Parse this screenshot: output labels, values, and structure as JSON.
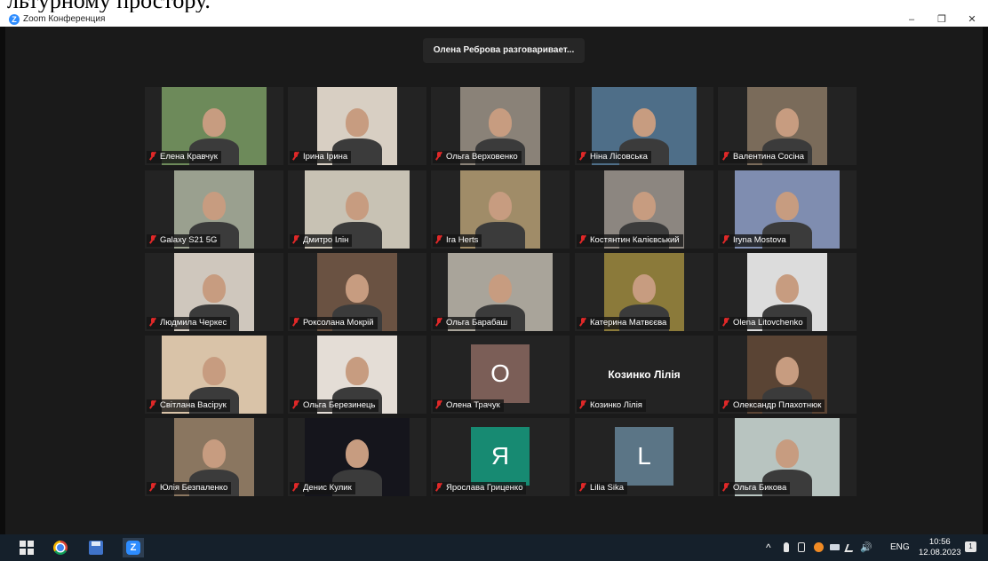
{
  "doc_fragment": "льтурному простору.",
  "window": {
    "title": "Zoom Конференция",
    "logo_letter": "Z",
    "minimize_glyph": "–",
    "restore_glyph": "❐",
    "close_glyph": "✕"
  },
  "speaking_banner": "Олена Реброва разговаривает...",
  "participants": [
    {
      "name": "Елена Кравчук",
      "kind": "video",
      "bg": "#6d8a5a"
    },
    {
      "name": "Ірина Ірина",
      "kind": "video",
      "bg": "#d8cfc3"
    },
    {
      "name": "Ольга Верховенко",
      "kind": "video",
      "bg": "#8a8278"
    },
    {
      "name": "Ніна Лісовська",
      "kind": "video",
      "bg": "#4e6e88"
    },
    {
      "name": "Валентина Сосіна",
      "kind": "video",
      "bg": "#7a6b5a"
    },
    {
      "name": "Galaxy S21 5G",
      "kind": "video",
      "bg": "#9aa08f"
    },
    {
      "name": "Дмитро Ілін",
      "kind": "video",
      "bg": "#c8c2b4"
    },
    {
      "name": "Ira Herts",
      "kind": "video",
      "bg": "#a08c68"
    },
    {
      "name": "Костянтин Калієвський",
      "kind": "video",
      "bg": "#8c8680"
    },
    {
      "name": "Iryna Mostova",
      "kind": "video",
      "bg": "#7f8db0"
    },
    {
      "name": "Людмила Черкес",
      "kind": "video",
      "bg": "#cfc7bd"
    },
    {
      "name": "Роксолана Мокрій",
      "kind": "video",
      "bg": "#6a5242"
    },
    {
      "name": "Ольга Барабаш",
      "kind": "video",
      "bg": "#a9a49a"
    },
    {
      "name": "Катерина Матвєєва",
      "kind": "video",
      "bg": "#8b7a3a"
    },
    {
      "name": "Olena Litovchenko",
      "kind": "video",
      "bg": "#dcdcdc"
    },
    {
      "name": "Світлана Васірук",
      "kind": "video",
      "bg": "#d9c3a8"
    },
    {
      "name": "Ольга Березинець",
      "kind": "video",
      "bg": "#e4ddd6"
    },
    {
      "name": "Олена Трачук",
      "kind": "avatar",
      "letter": "O",
      "bg": "#7b5e57"
    },
    {
      "name": "Козинко Лілія",
      "kind": "text",
      "display_name": "Козинко Лілія"
    },
    {
      "name": "Олександр Плахотнюк",
      "kind": "video",
      "bg": "#5a4434"
    },
    {
      "name": "Юлія Безпаленко",
      "kind": "video",
      "bg": "#8a7660"
    },
    {
      "name": "Денис Кулик",
      "kind": "video",
      "bg": "#15151c"
    },
    {
      "name": "Ярослава Гриценко",
      "kind": "avatar",
      "letter": "Я",
      "bg": "#178a72"
    },
    {
      "name": "Lilia Sika",
      "kind": "avatar",
      "letter": "L",
      "bg": "#5b7586"
    },
    {
      "name": "Ольга Бикова",
      "kind": "video",
      "bg": "#b8c4c0"
    }
  ],
  "taskbar": {
    "tray_up_arrow": "^",
    "language": "ENG",
    "time": "10:56",
    "date": "12.08.2023",
    "notifications": "1",
    "zoom_letter": "Z"
  }
}
